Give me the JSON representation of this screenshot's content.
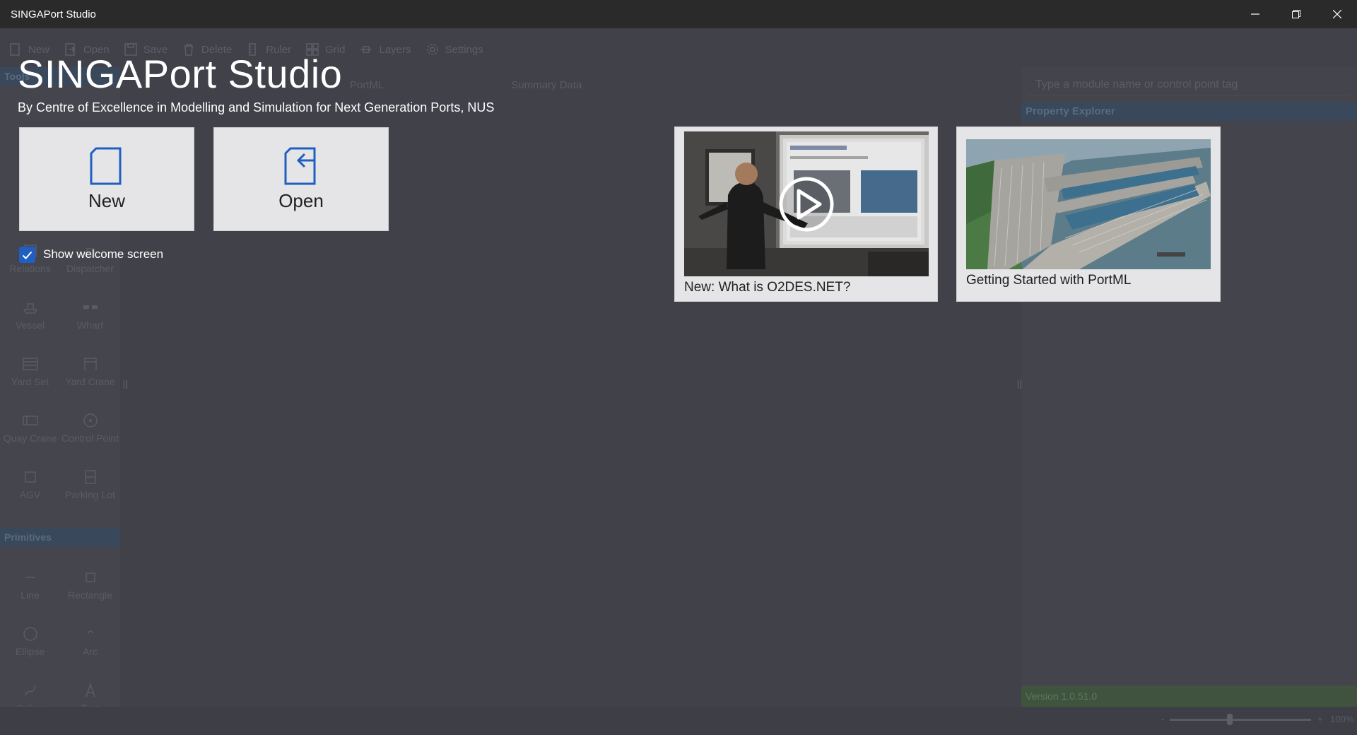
{
  "window": {
    "title": "SINGAPort Studio",
    "minimize_glyph": "─",
    "restore_glyph": "❐",
    "close_glyph": "✕"
  },
  "toolbar": [
    {
      "label": "New",
      "icon": "new-file-icon"
    },
    {
      "label": "Open",
      "icon": "open-folder-icon"
    },
    {
      "label": "Save",
      "icon": "save-icon"
    },
    {
      "label": "Delete",
      "icon": "trash-icon"
    },
    {
      "label": "Ruler",
      "icon": "ruler-icon"
    },
    {
      "label": "Grid",
      "icon": "grid-icon"
    },
    {
      "label": "Layers",
      "icon": "layers-icon"
    },
    {
      "label": "Settings",
      "icon": "gear-icon"
    }
  ],
  "left_panel": {
    "header": "Tools",
    "modules": [
      "Relations",
      "Dispatcher",
      "Vessel",
      "Wharf",
      "Yard Set",
      "Yard Crane",
      "Quay Crane",
      "Control Point",
      "AGV",
      "Parking Lot"
    ],
    "primitives_header": "Primitives",
    "primitives": [
      "Line",
      "Rectangle",
      "Ellipse",
      "Arc",
      "Spline",
      "Text"
    ]
  },
  "center_tabs": [
    "PortML",
    "Summary Data"
  ],
  "right_panel": {
    "search_placeholder": "Type a module name or control point tag",
    "property_header": "Property Explorer",
    "version": "Version 1.0.51.0"
  },
  "statusbar": {
    "zoom_minus": "-",
    "zoom_plus": "+",
    "zoom_label": "100%",
    "zoom_fraction": 0.42
  },
  "welcome": {
    "title": "SINGAPort Studio",
    "subtitle": "By Centre of Excellence in Modelling and Simulation for Next Generation Ports, NUS",
    "new_label": "New",
    "open_label": "Open",
    "show_welcome_label": "Show welcome screen",
    "show_welcome_checked": true,
    "cards": [
      {
        "caption": "New: What is O2DES.NET?",
        "icon": "play-icon"
      },
      {
        "caption": "Getting Started with PortML",
        "icon": "port-aerial-image"
      }
    ]
  },
  "colors": {
    "accent": "#1f5fc2",
    "panel_header": "#39485a",
    "version_bar": "#3f533e"
  }
}
